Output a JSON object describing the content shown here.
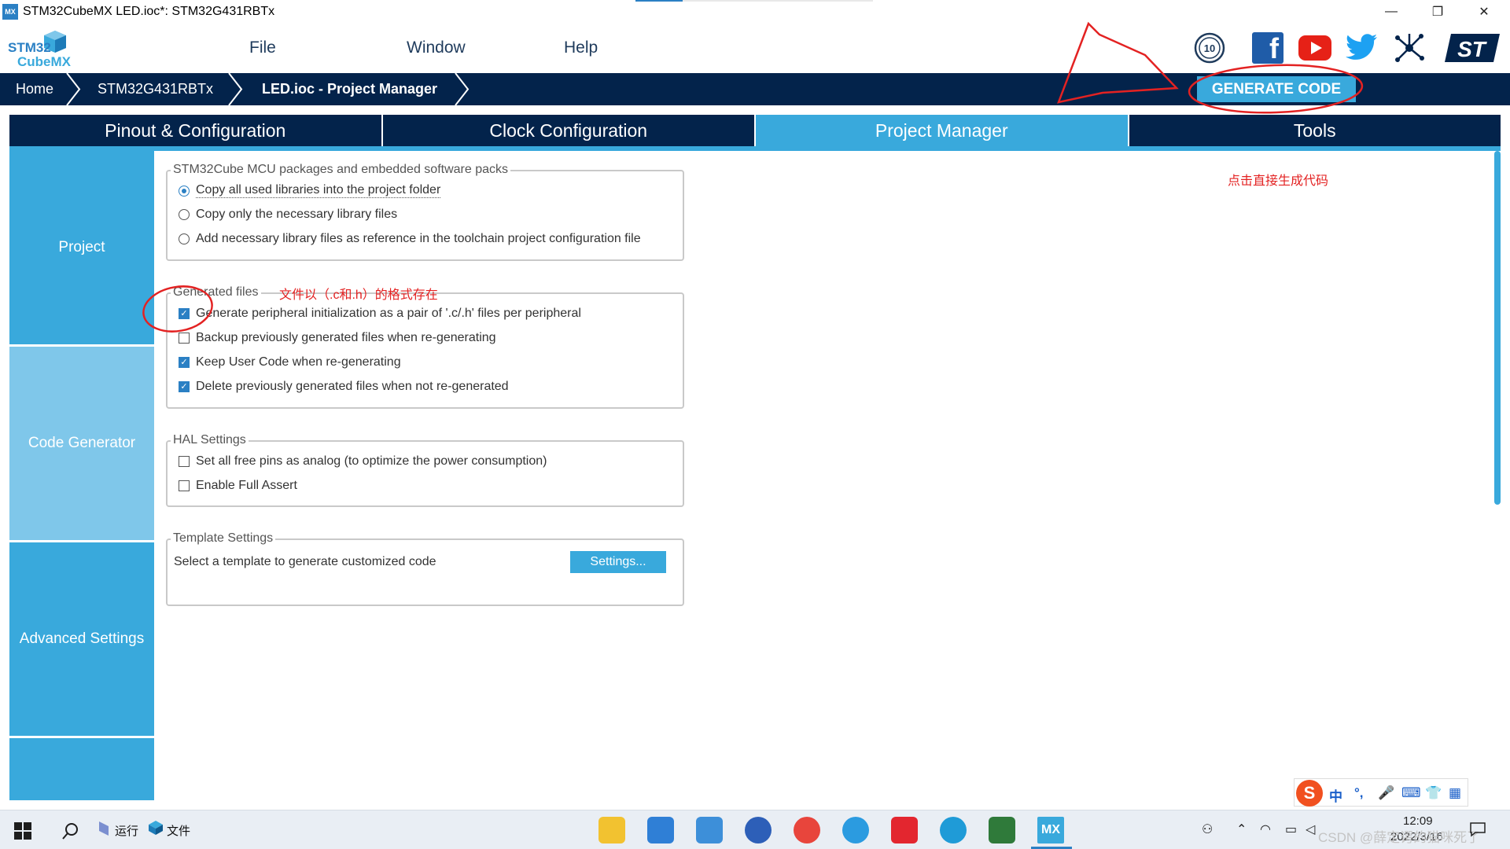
{
  "window": {
    "title": "STM32CubeMX LED.ioc*: STM32G431RBTx",
    "app_icon_text": "MX",
    "minimize": "—",
    "maximize": "❐",
    "close": "✕"
  },
  "logo": {
    "line1": "STM32",
    "line2": "CubeMX"
  },
  "menu": {
    "file": "File",
    "window": "Window",
    "help": "Help"
  },
  "social": {
    "anniversary": "10",
    "facebook": "f",
    "st": "ST"
  },
  "breadcrumb": {
    "home": "Home",
    "mcu": "STM32G431RBTx",
    "current": "LED.ioc - Project Manager"
  },
  "generate_button": "GENERATE CODE",
  "tabs": {
    "pinout": "Pinout & Configuration",
    "clock": "Clock Configuration",
    "project_manager": "Project Manager",
    "tools": "Tools"
  },
  "sidebar": {
    "project": "Project",
    "code_generator": "Code Generator",
    "advanced": "Advanced Settings"
  },
  "packages": {
    "title": "STM32Cube MCU packages and embedded software packs",
    "opt1": "Copy all used libraries into the project folder",
    "opt2": "Copy only the necessary library files",
    "opt3": "Add necessary library files as reference in the toolchain project configuration file"
  },
  "generated": {
    "title": "Generated files",
    "opt1": "Generate peripheral initialization as a pair of '.c/.h' files per peripheral",
    "opt2": "Backup previously generated files when re-generating",
    "opt3": "Keep User Code when re-generating",
    "opt4": "Delete previously generated files when not re-generated",
    "check_mark": "✓"
  },
  "hal": {
    "title": "HAL Settings",
    "opt1": "Set all free pins as analog (to optimize the power consumption)",
    "opt2": "Enable Full Assert"
  },
  "template": {
    "title": "Template Settings",
    "label": "Select a template to generate customized code",
    "button": "Settings..."
  },
  "annotations": {
    "generate_note": "点击直接生成代码",
    "files_note": "文件以（.c和.h）的格式存在"
  },
  "taskbar": {
    "run": "运行",
    "files": "文件",
    "mx": "MX",
    "time": "12:09",
    "date": "2022/3/16",
    "watermark": "CSDN @薛定谔的猫咪死了"
  },
  "ime": {
    "zh": "中",
    "punct": "°,",
    "mic": "🎤",
    "kbd": "⌨",
    "shirt": "👕",
    "grid": "▦",
    "logo": "S"
  },
  "colors": {
    "navy": "#03234b",
    "accent": "#39a9dc",
    "light_accent": "#7fc7ea",
    "annotation": "#e32222"
  }
}
